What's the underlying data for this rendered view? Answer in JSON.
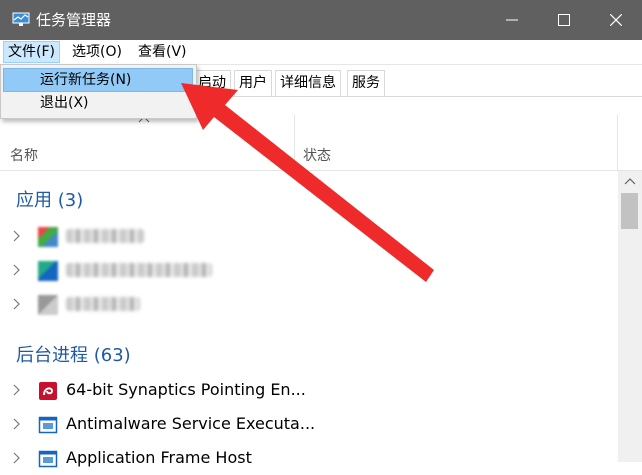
{
  "window": {
    "title": "任务管理器"
  },
  "menubar": {
    "items": [
      "文件(F)",
      "选项(O)",
      "查看(V)"
    ]
  },
  "dropdown": {
    "items": [
      "运行新任务(N)",
      "退出(X)"
    ]
  },
  "tabs": [
    "启动",
    "用户",
    "详细信息",
    "服务"
  ],
  "columns": {
    "name": "名称",
    "status": "状态"
  },
  "apps": {
    "label": "应用 (3)"
  },
  "background": {
    "label": "后台进程 (63)",
    "rows": [
      "64-bit Synaptics Pointing En...",
      "Antimalware Service Executa...",
      "Application Frame Host"
    ]
  },
  "colors": {
    "accent": "#1f5aa6",
    "annotation_arrow": "#ee2a2a",
    "titlebar": "#606060"
  }
}
